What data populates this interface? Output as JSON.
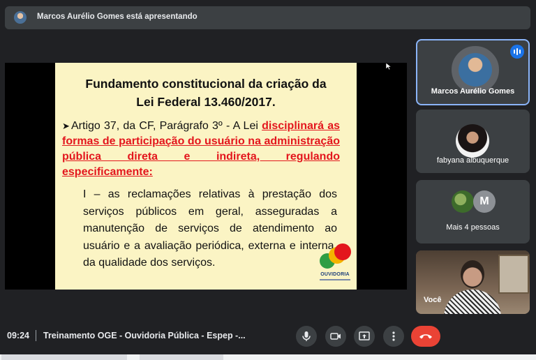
{
  "presenting_bar": {
    "text": "Marcos Aurélio Gomes está apresentando"
  },
  "slide": {
    "title_line1": "Fundamento constitucional da criação da",
    "title_line2": "Lei  Federal 13.460/2017.",
    "bullet_prefix": "Artigo 37, da CF, Parágrafo 3º - A Lei",
    "bullet_red": "disciplinará as formas de participação do usuário na administração pública direta e indireta, regulando especificamente:",
    "item_text": "I – as reclamações relativas à prestação dos serviços públicos em geral, asseguradas a manutenção de serviços de atendimento ao usuário e a avaliação periódica, externa e interna, da qualidade dos serviços.",
    "logo_text": "OUVIDORIA",
    "bullet_icon": "arrow-bullet-icon"
  },
  "participants": [
    {
      "name": "Marcos Aurélio Gomes",
      "speaking": true
    },
    {
      "name": "fabyana albuquerque"
    },
    {
      "name": "Mais 4 pessoas",
      "initial": "M"
    },
    {
      "name": "Você"
    }
  ],
  "bottom_bar": {
    "time": "09:24",
    "meeting_title": "Treinamento OGE - Ouvidoria Pública - Espep -..."
  },
  "colors": {
    "background": "#202124",
    "tile": "#3c4043",
    "slide_bg": "#fbf4c4",
    "slide_red": "#e3161d",
    "active_border": "#8ab4f8",
    "end_call": "#ea4335"
  }
}
